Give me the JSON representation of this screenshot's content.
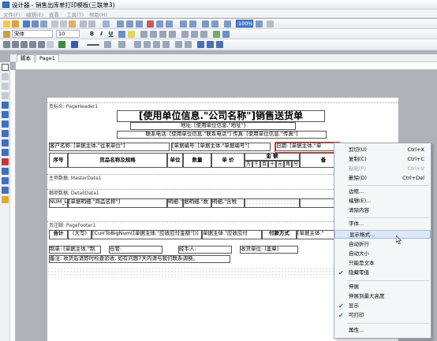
{
  "window": {
    "title": "设计器 - 销售出库单打印模板(三联单3)"
  },
  "menu": {
    "items": [
      "文件(F)",
      "编辑(E)",
      "查看",
      "工具(T)",
      "帮助(H)"
    ]
  },
  "toolbar": {
    "font_name": "宋体",
    "font_size": "10",
    "zoom": "100%"
  },
  "tabs": {
    "items": [
      "脚本",
      "Page1"
    ]
  },
  "report": {
    "page_header_label": "页标头: PageHeader1",
    "title": "[使用单位信息.\"公司名称\"]销售送货单",
    "address": "地址: [使用单位信息.\"地址\"]",
    "contact": "联系电话: [使用单位信息.\"联系电话\"]  传真: [使用单位信息.\"传真\"]",
    "customer": "客户名称: [单据主体.\"往来单位\"]",
    "bill_no": "[单据编号: [单据主体.\"单据编号\"]",
    "date": "日期: [单据主体.\"单",
    "headers": {
      "seq": "序号",
      "name": "货品名称及规格",
      "unit": "单位",
      "qty": "数量",
      "price": "单 价",
      "amount": "金 额",
      "remark": "备",
      "amount_units": [
        "万",
        "千",
        "百",
        "十",
        "元",
        "角",
        "分"
      ]
    },
    "master_label": "主项数据: MasterData1",
    "detail_label": "细项数据: DetailData1",
    "detail_row": [
      "NUM_Line",
      "[单据明细.\"商品名称\"]",
      "明细.\"",
      "据明细.\"数",
      "明细.\"含税"
    ],
    "footer_label": "页注脚: PageFooter1",
    "total": "合计",
    "total_upper": "(大写)",
    "total_expr": "[CurrToBigNum([单据主体.\"应收应付金额\"])]",
    "total_amount": "单据主体.\"应收应付",
    "pay_method": "付款方式",
    "pay_value": "[单据主体.\"",
    "maker": "制单: [单据主体.\"制",
    "warehouse": "仓管:",
    "handler": "经手人:",
    "receiver": "收货单位: (盖章)",
    "note": "备注: 收货后请即时检查验收, 如有问题7天内请与我们联系调换。"
  },
  "context_menu": {
    "items": [
      {
        "label": "剪切(U)",
        "shortcut": "Ctrl+X",
        "enabled": true,
        "checked": false
      },
      {
        "label": "复制(C)",
        "shortcut": "Ctrl+C",
        "enabled": true,
        "checked": false
      },
      {
        "label": "粘贴(P)",
        "shortcut": "Ctrl+V",
        "enabled": false,
        "checked": false
      },
      {
        "label": "删除(D)",
        "shortcut": "Ctrl+Del",
        "enabled": true,
        "checked": false
      },
      {
        "label": "边框...",
        "shortcut": "",
        "enabled": true,
        "checked": false
      },
      {
        "label": "编辑(E)...",
        "shortcut": "",
        "enabled": true,
        "checked": false
      },
      {
        "label": "清除内容",
        "shortcut": "",
        "enabled": true,
        "checked": false
      },
      {
        "label": "字体...",
        "shortcut": "",
        "enabled": true,
        "checked": false
      },
      {
        "label": "显示格式...",
        "shortcut": "",
        "enabled": true,
        "checked": false,
        "highlighted": true
      },
      {
        "label": "自动折行",
        "shortcut": "",
        "enabled": true,
        "checked": false
      },
      {
        "label": "自动大小",
        "shortcut": "",
        "enabled": true,
        "checked": false
      },
      {
        "label": "只能是文本",
        "shortcut": "",
        "enabled": true,
        "checked": false
      },
      {
        "label": "隐藏零值",
        "shortcut": "",
        "enabled": true,
        "checked": true
      },
      {
        "label": "伸展",
        "shortcut": "",
        "enabled": true,
        "checked": false
      },
      {
        "label": "伸展到最大高度",
        "shortcut": "",
        "enabled": true,
        "checked": false
      },
      {
        "label": "显示",
        "shortcut": "",
        "enabled": true,
        "checked": true
      },
      {
        "label": "可打印",
        "shortcut": "",
        "enabled": true,
        "checked": true
      },
      {
        "label": "属性...",
        "shortcut": "",
        "enabled": true,
        "checked": false
      }
    ]
  },
  "colors": {
    "highlight_border": "#e23b3b",
    "menu_highlight": "#dde8f7",
    "accent": "#1f5fbf"
  }
}
